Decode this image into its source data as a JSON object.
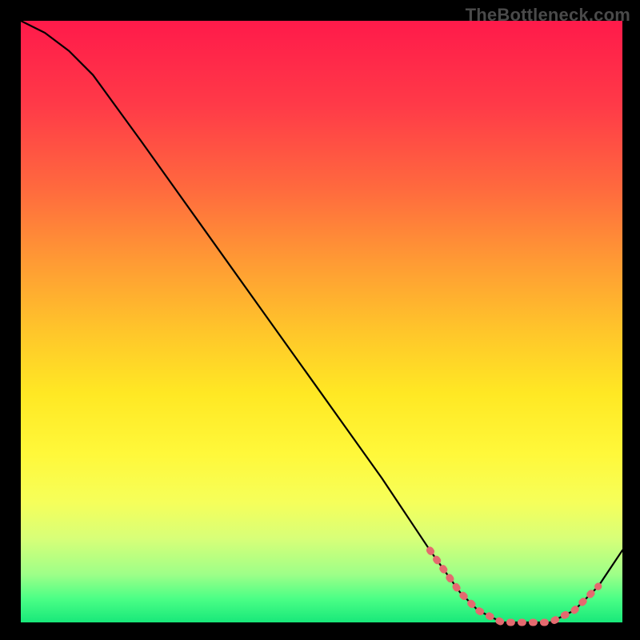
{
  "watermark": "TheBottleneck.com",
  "chart_data": {
    "type": "line",
    "title": "",
    "xlabel": "",
    "ylabel": "",
    "xlim": [
      0,
      100
    ],
    "ylim": [
      0,
      100
    ],
    "series": [
      {
        "name": "curve",
        "x": [
          0,
          4,
          8,
          12,
          20,
          30,
          40,
          50,
          60,
          68,
          73,
          76,
          80,
          84,
          88,
          92,
          96,
          100
        ],
        "y": [
          100,
          98,
          95,
          91,
          80,
          66,
          52,
          38,
          24,
          12,
          5,
          2,
          0,
          0,
          0,
          2,
          6,
          12
        ]
      }
    ],
    "annotations": [
      {
        "name": "dotted-highlight",
        "x": [
          68,
          73,
          76,
          80,
          84,
          88,
          92,
          96
        ],
        "y": [
          12,
          5,
          2,
          0,
          0,
          0,
          2,
          6
        ]
      }
    ],
    "background_gradient": {
      "top": "#ff1a4a",
      "mid": "#ffe824",
      "bottom": "#18e87a"
    }
  }
}
